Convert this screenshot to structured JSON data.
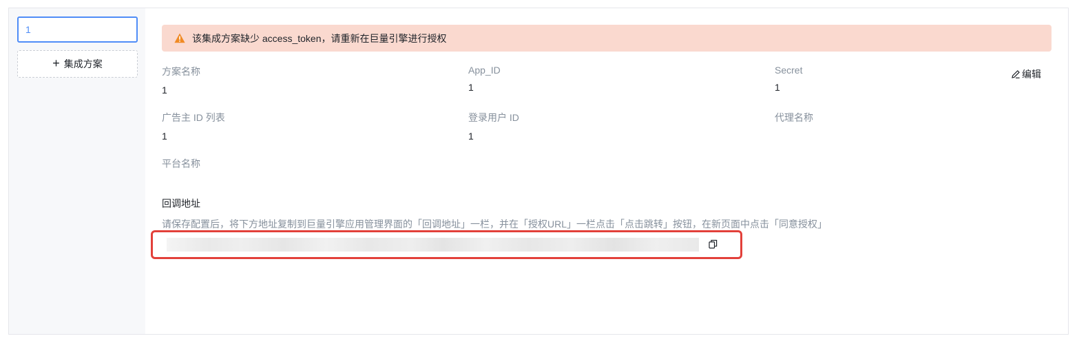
{
  "sidebar": {
    "plan_item": "1",
    "add_plan_label": "集成方案"
  },
  "alert": {
    "text": "该集成方案缺少 access_token，请重新在巨量引擎进行授权",
    "color": "#fad9cf",
    "icon": "warning-icon"
  },
  "edit_label": "编辑",
  "fields": {
    "plan_name": {
      "label": "方案名称",
      "value": "1"
    },
    "app_id": {
      "label": "App_ID",
      "value": "1"
    },
    "secret": {
      "label": "Secret",
      "value": "1"
    },
    "advertiser_ids": {
      "label": "广告主 ID 列表",
      "value": "1"
    },
    "login_user_id": {
      "label": "登录用户 ID",
      "value": "1"
    },
    "agent_name": {
      "label": "代理名称",
      "value": ""
    },
    "platform_name": {
      "label": "平台名称",
      "value": ""
    }
  },
  "callback": {
    "title": "回调地址",
    "hint": "请保存配置后，将下方地址复制到巨量引擎应用管理界面的「回调地址」一栏，并在「授权URL」一栏点击「点击跳转」按钮，在新页面中点击「同意授权」",
    "highlight_color": "#e2403a"
  }
}
